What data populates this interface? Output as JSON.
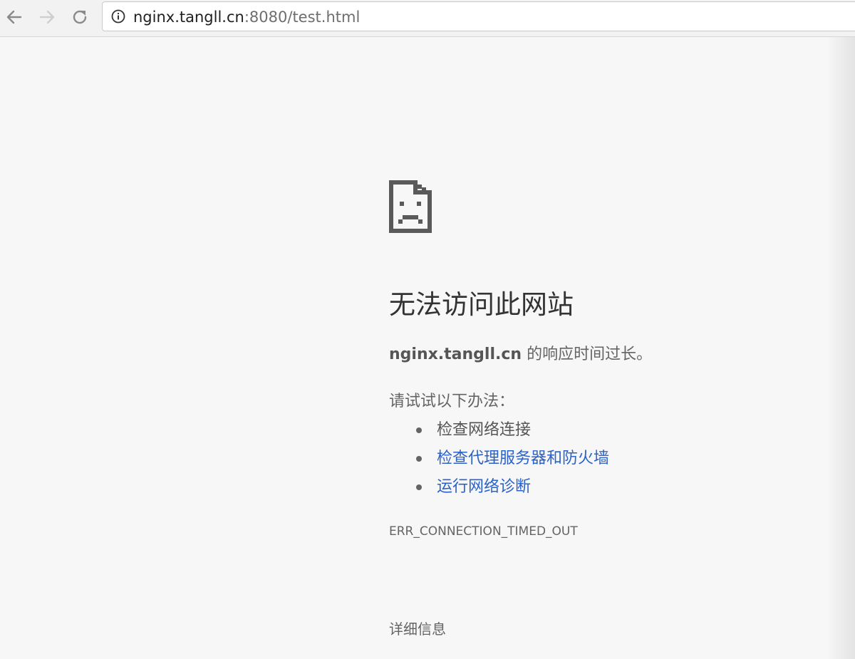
{
  "browser": {
    "url_host": "nginx.tangll.cn",
    "url_rest": ":8080/test.html",
    "back_icon": "arrow-left-icon",
    "forward_icon": "arrow-right-icon",
    "reload_icon": "reload-icon",
    "site_info_icon": "info-circle-icon"
  },
  "error_page": {
    "icon": "sad-document-icon",
    "heading": "无法访问此网站",
    "summary_host": "nginx.tangll.cn",
    "summary_text": " 的响应时间过长。",
    "try_label": "请试试以下办法：",
    "suggestions": [
      {
        "label": "检查网络连接",
        "link": false
      },
      {
        "label": "检查代理服务器和防火墙",
        "link": true
      },
      {
        "label": "运行网络诊断",
        "link": true
      }
    ],
    "error_code": "ERR_CONNECTION_TIMED_OUT",
    "details_button": "详细信息"
  },
  "colors": {
    "page_background": "#f7f7f7",
    "link": "#2a62c9",
    "body_text": "#646464",
    "heading_text": "#333333"
  }
}
